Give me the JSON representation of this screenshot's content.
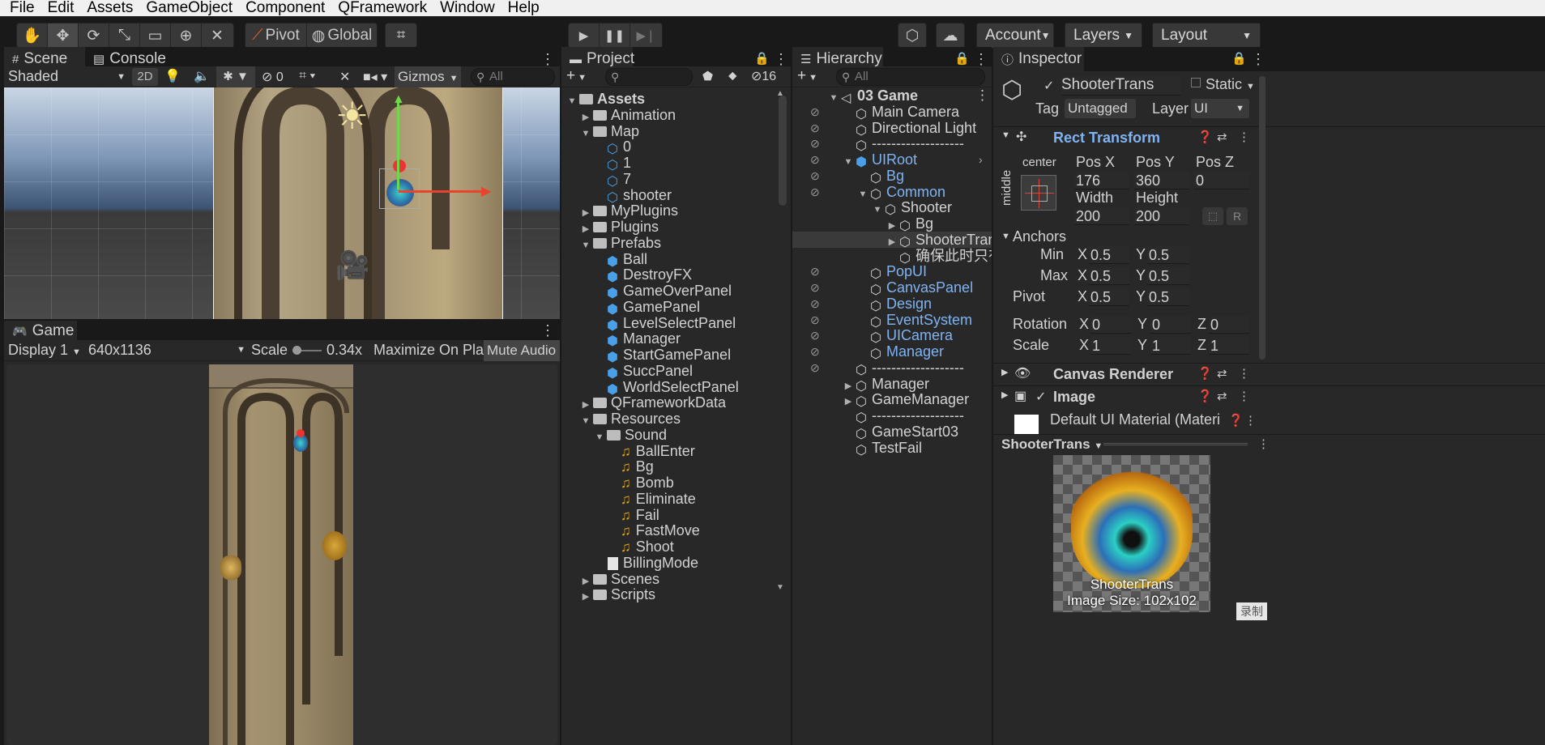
{
  "menu": [
    "File",
    "Edit",
    "Assets",
    "GameObject",
    "Component",
    "QFramework",
    "Window",
    "Help"
  ],
  "toolbar": {
    "pivot": "Pivot",
    "global": "Global",
    "account": "Account",
    "layers": "Layers",
    "layout": "Layout"
  },
  "scene": {
    "tab_scene": "Scene",
    "tab_console": "Console",
    "shading": "Shaded",
    "mode_2d": "2D",
    "hidden_count": "0",
    "gizmos": "Gizmos",
    "search_placeholder": "All"
  },
  "game": {
    "tab": "Game",
    "display": "Display 1",
    "resolution": "640x1136",
    "scale_label": "Scale",
    "scale_value": "0.34x",
    "maximize": "Maximize On Play",
    "mute": "Mute Audio"
  },
  "project": {
    "tab": "Project",
    "badge_count": "16",
    "items": [
      {
        "label": "Assets",
        "depth": 0,
        "kind": "folder-open",
        "arrow": "▼",
        "bold": true
      },
      {
        "label": "Animation",
        "depth": 1,
        "kind": "folder",
        "arrow": "▶"
      },
      {
        "label": "Map",
        "depth": 1,
        "kind": "folder-open",
        "arrow": "▼"
      },
      {
        "label": "0",
        "depth": 2,
        "kind": "prefab-var",
        "arrow": ""
      },
      {
        "label": "1",
        "depth": 2,
        "kind": "prefab-var",
        "arrow": ""
      },
      {
        "label": "7",
        "depth": 2,
        "kind": "prefab-var",
        "arrow": ""
      },
      {
        "label": "shooter",
        "depth": 2,
        "kind": "prefab-var",
        "arrow": ""
      },
      {
        "label": "MyPlugins",
        "depth": 1,
        "kind": "folder",
        "arrow": "▶"
      },
      {
        "label": "Plugins",
        "depth": 1,
        "kind": "folder",
        "arrow": "▶"
      },
      {
        "label": "Prefabs",
        "depth": 1,
        "kind": "folder-open",
        "arrow": "▼"
      },
      {
        "label": "Ball",
        "depth": 2,
        "kind": "prefab",
        "arrow": ""
      },
      {
        "label": "DestroyFX",
        "depth": 2,
        "kind": "prefab",
        "arrow": ""
      },
      {
        "label": "GameOverPanel",
        "depth": 2,
        "kind": "prefab",
        "arrow": ""
      },
      {
        "label": "GamePanel",
        "depth": 2,
        "kind": "prefab",
        "arrow": ""
      },
      {
        "label": "LevelSelectPanel",
        "depth": 2,
        "kind": "prefab",
        "arrow": ""
      },
      {
        "label": "Manager",
        "depth": 2,
        "kind": "prefab",
        "arrow": ""
      },
      {
        "label": "StartGamePanel",
        "depth": 2,
        "kind": "prefab",
        "arrow": ""
      },
      {
        "label": "SuccPanel",
        "depth": 2,
        "kind": "prefab",
        "arrow": ""
      },
      {
        "label": "WorldSelectPanel",
        "depth": 2,
        "kind": "prefab",
        "arrow": ""
      },
      {
        "label": "QFrameworkData",
        "depth": 1,
        "kind": "folder",
        "arrow": "▶"
      },
      {
        "label": "Resources",
        "depth": 1,
        "kind": "folder-open",
        "arrow": "▼"
      },
      {
        "label": "Sound",
        "depth": 2,
        "kind": "folder-open",
        "arrow": "▼"
      },
      {
        "label": "BallEnter",
        "depth": 3,
        "kind": "audio",
        "arrow": ""
      },
      {
        "label": "Bg",
        "depth": 3,
        "kind": "audio",
        "arrow": ""
      },
      {
        "label": "Bomb",
        "depth": 3,
        "kind": "audio",
        "arrow": ""
      },
      {
        "label": "Eliminate",
        "depth": 3,
        "kind": "audio",
        "arrow": ""
      },
      {
        "label": "Fail",
        "depth": 3,
        "kind": "audio",
        "arrow": ""
      },
      {
        "label": "FastMove",
        "depth": 3,
        "kind": "audio",
        "arrow": ""
      },
      {
        "label": "Shoot",
        "depth": 3,
        "kind": "audio",
        "arrow": ""
      },
      {
        "label": "BillingMode",
        "depth": 2,
        "kind": "doc",
        "arrow": ""
      },
      {
        "label": "Scenes",
        "depth": 1,
        "kind": "folder",
        "arrow": "▶"
      },
      {
        "label": "Scripts",
        "depth": 1,
        "kind": "folder",
        "arrow": "▶"
      }
    ]
  },
  "hierarchy": {
    "tab": "Hierarchy",
    "search_placeholder": "All",
    "items": [
      {
        "label": "03 Game",
        "depth": 0,
        "kind": "scene",
        "arrow": "▼",
        "bold": true,
        "eye": false
      },
      {
        "label": "Main Camera",
        "depth": 1,
        "kind": "cube",
        "arrow": "",
        "eye": true
      },
      {
        "label": "Directional Light",
        "depth": 1,
        "kind": "cube",
        "arrow": "",
        "eye": true
      },
      {
        "label": "-------------------",
        "depth": 1,
        "kind": "cube",
        "arrow": "",
        "eye": true
      },
      {
        "label": "UIRoot",
        "depth": 1,
        "kind": "cube-blue",
        "arrow": "▼",
        "blue": true,
        "eye": true,
        "more": true
      },
      {
        "label": "Bg",
        "depth": 2,
        "kind": "cube",
        "arrow": "",
        "blue": true,
        "eye": true
      },
      {
        "label": "Common",
        "depth": 2,
        "kind": "cube",
        "arrow": "▼",
        "blue": true,
        "eye": true
      },
      {
        "label": "Shooter",
        "depth": 3,
        "kind": "cube",
        "arrow": "▼",
        "eye": false
      },
      {
        "label": "Bg",
        "depth": 4,
        "kind": "cube",
        "arrow": "▶",
        "eye": false
      },
      {
        "label": "ShooterTrans",
        "depth": 4,
        "kind": "cube",
        "arrow": "▶",
        "eye": false,
        "selected": true
      },
      {
        "label": "确保此时只有一",
        "depth": 4,
        "kind": "cube",
        "arrow": "",
        "eye": false
      },
      {
        "label": "PopUI",
        "depth": 2,
        "kind": "cube",
        "arrow": "",
        "blue": true,
        "eye": true
      },
      {
        "label": "CanvasPanel",
        "depth": 2,
        "kind": "cube",
        "arrow": "",
        "blue": true,
        "eye": true
      },
      {
        "label": "Design",
        "depth": 2,
        "kind": "cube",
        "arrow": "",
        "blue": true,
        "eye": true
      },
      {
        "label": "EventSystem",
        "depth": 2,
        "kind": "cube",
        "arrow": "",
        "blue": true,
        "eye": true
      },
      {
        "label": "UICamera",
        "depth": 2,
        "kind": "cube",
        "arrow": "",
        "blue": true,
        "eye": true
      },
      {
        "label": "Manager",
        "depth": 2,
        "kind": "cube",
        "arrow": "",
        "blue": true,
        "eye": true
      },
      {
        "label": "-------------------",
        "depth": 1,
        "kind": "cube",
        "arrow": "",
        "eye": true
      },
      {
        "label": "Manager",
        "depth": 1,
        "kind": "cube",
        "arrow": "▶",
        "eye": false
      },
      {
        "label": "GameManager",
        "depth": 1,
        "kind": "cube",
        "arrow": "▶",
        "eye": false
      },
      {
        "label": "-------------------",
        "depth": 1,
        "kind": "cube",
        "arrow": "",
        "eye": false
      },
      {
        "label": "GameStart03",
        "depth": 1,
        "kind": "cube",
        "arrow": "",
        "eye": false
      },
      {
        "label": "TestFail",
        "depth": 1,
        "kind": "cube",
        "arrow": "",
        "eye": false
      }
    ]
  },
  "inspector": {
    "tab": "Inspector",
    "object_name": "ShooterTrans",
    "static_label": "Static",
    "tag_label": "Tag",
    "tag_value": "Untagged",
    "layer_label": "Layer",
    "layer_value": "UI",
    "rect_transform": "Rect Transform",
    "anchor_h": "center",
    "anchor_v": "middle",
    "pos_x_label": "Pos X",
    "pos_y_label": "Pos Y",
    "pos_z_label": "Pos Z",
    "pos_x": "176",
    "pos_y": "360",
    "pos_z": "0",
    "width_label": "Width",
    "height_label": "Height",
    "width": "200",
    "height": "200",
    "r_btn": "R",
    "anchors_label": "Anchors",
    "min_label": "Min",
    "max_label": "Max",
    "pivot_label": "Pivot",
    "min_x": "0.5",
    "min_y": "0.5",
    "max_x": "0.5",
    "max_y": "0.5",
    "pivot_x": "0.5",
    "pivot_y": "0.5",
    "rotation_label": "Rotation",
    "rot_x": "0",
    "rot_y": "0",
    "rot_z": "0",
    "scale_label": "Scale",
    "scale_x": "1",
    "scale_y": "1",
    "scale_z": "1",
    "x": "X",
    "y": "Y",
    "z": "Z",
    "canvas_renderer": "Canvas Renderer",
    "image": "Image",
    "material": "Default UI Material (Materi",
    "preview_title": "ShooterTrans",
    "preview_name": "ShooterTrans",
    "preview_size": "Image Size: 102x102"
  },
  "watermark": "录制",
  "colors": {
    "accent_blue": "#7fb3f2",
    "panel_bg": "#282828",
    "dark_bg": "#191919",
    "gizmo_green": "#6fd84a",
    "gizmo_red": "#e8442c"
  }
}
